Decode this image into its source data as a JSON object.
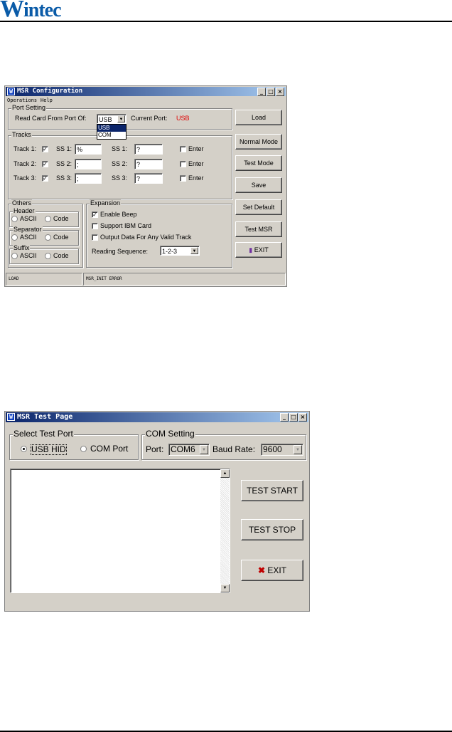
{
  "logo": {
    "text_w": "W",
    "text_rest": "intec"
  },
  "msr_config": {
    "title": "MSR Configuration",
    "menu": [
      "Operations",
      "Help"
    ],
    "port_setting": {
      "legend": "Port Setting",
      "read_label": "Read Card From Port Of:",
      "port_value": "USB",
      "current_port_label": "Current Port:",
      "current_port_value": "USB",
      "dropdown_options": [
        "USB",
        "COM"
      ]
    },
    "tracks": {
      "legend": "Tracks",
      "rows": [
        {
          "label": "Track 1:",
          "ss_label": "SS 1:",
          "ss_value": "%",
          "es_label": "SS 1:",
          "es_value": "?",
          "enter": "Enter"
        },
        {
          "label": "Track 2:",
          "ss_label": "SS 2:",
          "ss_value": ";",
          "es_label": "SS 2:",
          "es_value": "?",
          "enter": "Enter"
        },
        {
          "label": "Track 3:",
          "ss_label": "SS 3:",
          "ss_value": ";",
          "es_label": "SS 3:",
          "es_value": "?",
          "enter": "Enter"
        }
      ]
    },
    "others": {
      "legend": "Others",
      "groups": [
        {
          "legend": "Header",
          "opt1": "ASCII",
          "opt2": "Code"
        },
        {
          "legend": "Separator",
          "opt1": "ASCII",
          "opt2": "Code"
        },
        {
          "legend": "Suffix",
          "opt1": "ASCII",
          "opt2": "Code"
        }
      ]
    },
    "expansion": {
      "legend": "Expansion",
      "enable_beep": "Enable Beep",
      "support_ibm": "Support IBM  Card",
      "output_any": "Output Data For Any Valid Track",
      "reading_seq_label": "Reading Sequence:",
      "reading_seq_value": "1-2-3"
    },
    "buttons": [
      "Load",
      "Normal Mode",
      "Test Mode",
      "Save",
      "Set Default",
      "Test MSR",
      "EXIT"
    ],
    "status": {
      "left": "LOAD",
      "right": "MSR_INIT ERROR"
    }
  },
  "msr_test": {
    "title": "MSR Test Page",
    "select_port": {
      "legend": "Select Test Port",
      "usb": "USB  HID",
      "com": "COM Port"
    },
    "com_setting": {
      "legend": "COM Setting",
      "port_label": "Port:",
      "port_value": "COM6",
      "baud_label": "Baud Rate:",
      "baud_value": "9600"
    },
    "buttons": {
      "start": "TEST START",
      "stop": "TEST STOP",
      "exit": "EXIT"
    }
  }
}
